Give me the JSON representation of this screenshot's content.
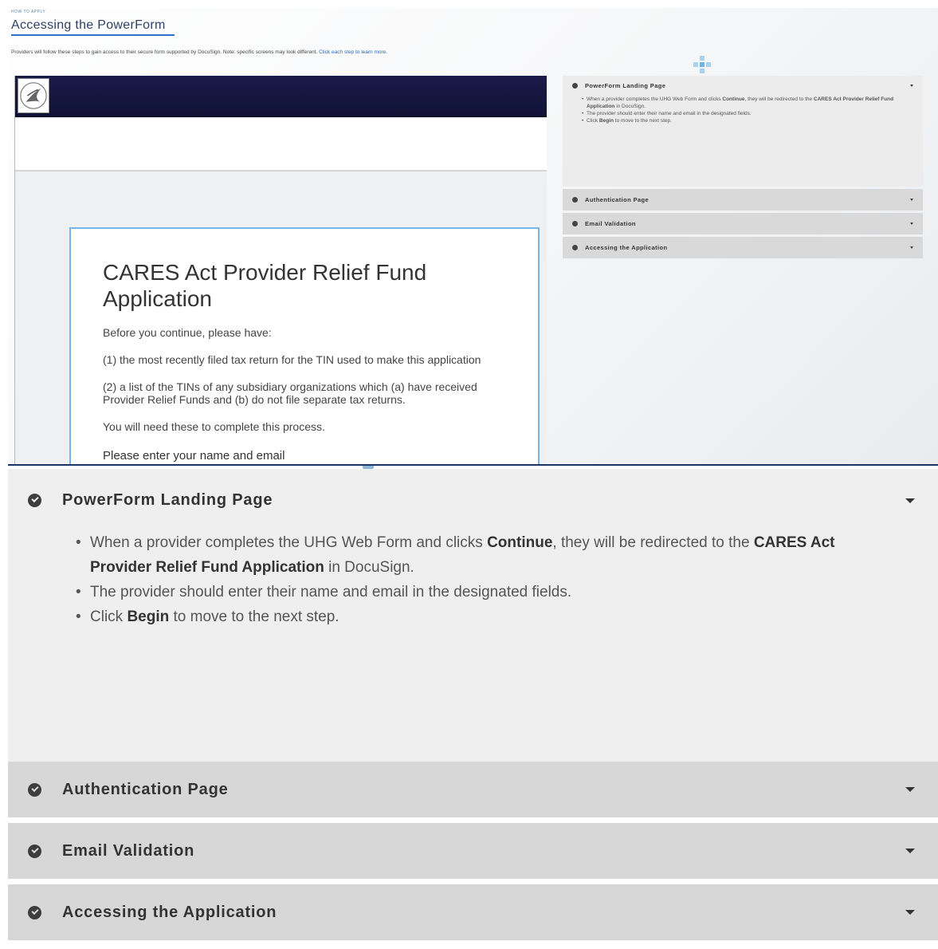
{
  "header": {
    "eyebrow": "HOW TO APPLY",
    "title": "Accessing the PowerForm",
    "intro": "Providers will follow these steps to gain access to their secure form supported by DocuSign. Note: specific screens may look different. ",
    "intro_link": "Click each step to learn more."
  },
  "screen": {
    "card_title": "CARES Act Provider Relief Fund Application",
    "p_before": "Before you continue, please have:",
    "p_item1": "(1) the most recently filed tax return for the TIN used to make this application",
    "p_item2": "(2) a list of the TINs of any subsidiary organizations which (a) have received Provider Relief Funds and (b) do not file separate tax returns.",
    "p_need": "You will need these to complete this process.",
    "p_enter": "Please enter your name and email"
  },
  "accordion": {
    "open_section": {
      "label": "PowerForm Landing Page",
      "bullet1_a": "When a provider completes the UHG Web Form and clicks ",
      "bullet1_b": "Continue",
      "bullet1_c": ", they will be redirected to the ",
      "bullet1_d": "CARES Act Provider Relief Fund Application",
      "bullet1_e": " in DocuSign.",
      "bullet2": "The provider should enter their name and email in the designated fields.",
      "bullet3_a": "Click ",
      "bullet3_b": "Begin",
      "bullet3_c": " to move to the next step."
    },
    "closed_sections": [
      {
        "label": "Authentication Page"
      },
      {
        "label": "Email Validation"
      },
      {
        "label": "Accessing the Application"
      }
    ]
  },
  "colors": {
    "accent": "#2d71c6",
    "header_navy": "#1a1a49",
    "card_border": "#77b4e6",
    "accordion_open_bg": "#efefef",
    "accordion_closed_bg": "#d7d7d7"
  },
  "icons": [
    "checkmark-circle-icon",
    "caret-down-icon",
    "plus-pattern-icon",
    "hhs-seal-icon"
  ]
}
